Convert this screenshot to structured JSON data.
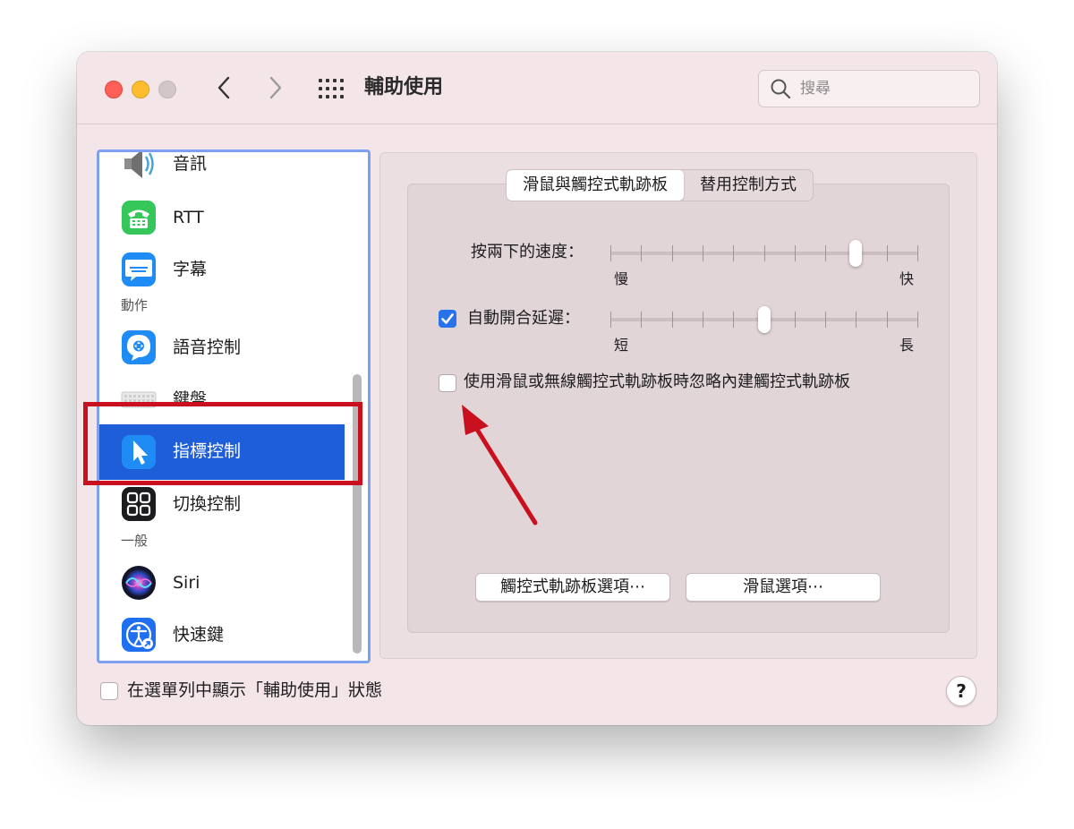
{
  "window": {
    "title": "輔助使用",
    "search_placeholder": "搜尋"
  },
  "sidebar": {
    "items": [
      {
        "label": "音訊",
        "icon": "speaker-icon"
      },
      {
        "label": "RTT",
        "icon": "rtt-phone-icon"
      },
      {
        "label": "字幕",
        "icon": "captions-icon"
      },
      {
        "label": "語音控制",
        "icon": "voice-control-icon"
      },
      {
        "label": "鍵盤",
        "icon": "keyboard-icon"
      },
      {
        "label": "指標控制",
        "icon": "pointer-icon",
        "selected": true
      },
      {
        "label": "切換控制",
        "icon": "switch-control-icon"
      },
      {
        "label": "Siri",
        "icon": "siri-icon"
      },
      {
        "label": "快速鍵",
        "icon": "accessibility-shortcut-icon"
      }
    ],
    "sections": {
      "motor": "動作",
      "general": "一般"
    }
  },
  "tabs": [
    {
      "label": "滑鼠與觸控式軌跡板",
      "active": true
    },
    {
      "label": "替用控制方式",
      "active": false
    }
  ],
  "double_click": {
    "label": "按兩下的速度：",
    "min_label": "慢",
    "max_label": "快",
    "value_fraction": 0.8
  },
  "spring_loading": {
    "label": "自動開合延遲：",
    "checked": true,
    "min_label": "短",
    "max_label": "長",
    "value_fraction": 0.5
  },
  "ignore_trackpad": {
    "label": "使用滑鼠或無線觸控式軌跡板時忽略內建觸控式軌跡板",
    "checked": false
  },
  "buttons": {
    "trackpad_options": "觸控式軌跡板選項⋯",
    "mouse_options": "滑鼠選項⋯"
  },
  "footer": {
    "show_status_label": "在選單列中顯示「輔助使用」狀態",
    "checked": false,
    "help": "?"
  },
  "colors": {
    "accent": "#1e5fd9",
    "annotation": "#c9101e",
    "window_bg": "#f4e6e8"
  }
}
